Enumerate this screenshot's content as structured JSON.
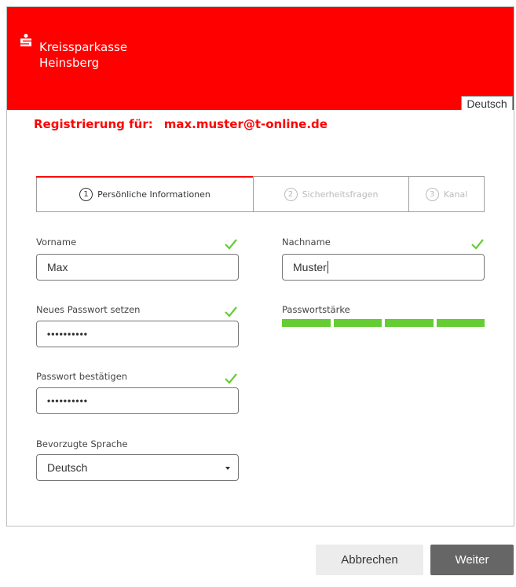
{
  "header": {
    "bank_name_line1": "Kreissparkasse",
    "bank_name_line2": "Heinsberg",
    "language_button": "Deutsch",
    "brand_color": "#ff0000"
  },
  "registration": {
    "label": "Registrierung für:",
    "email": "max.muster@t-online.de"
  },
  "steps": [
    {
      "number": "1",
      "label": "Persönliche Informationen",
      "active": true
    },
    {
      "number": "2",
      "label": "Sicherheitsfragen",
      "active": false
    },
    {
      "number": "3",
      "label": "Kanal",
      "active": false
    }
  ],
  "form": {
    "first_name": {
      "label": "Vorname",
      "value": "Max",
      "valid": true
    },
    "last_name": {
      "label": "Nachname",
      "value": "Muster",
      "valid": true
    },
    "new_password": {
      "label": "Neues Passwort setzen",
      "value": "••••••••••",
      "valid": true
    },
    "confirm_password": {
      "label": "Passwort bestätigen",
      "value": "••••••••••",
      "valid": true
    },
    "strength": {
      "label": "Passwortstärke",
      "filled_segments": 4,
      "total_segments": 4,
      "color": "#66cc33"
    },
    "language": {
      "label": "Bevorzugte Sprache",
      "value": "Deutsch"
    }
  },
  "actions": {
    "cancel": "Abbrechen",
    "next": "Weiter"
  }
}
